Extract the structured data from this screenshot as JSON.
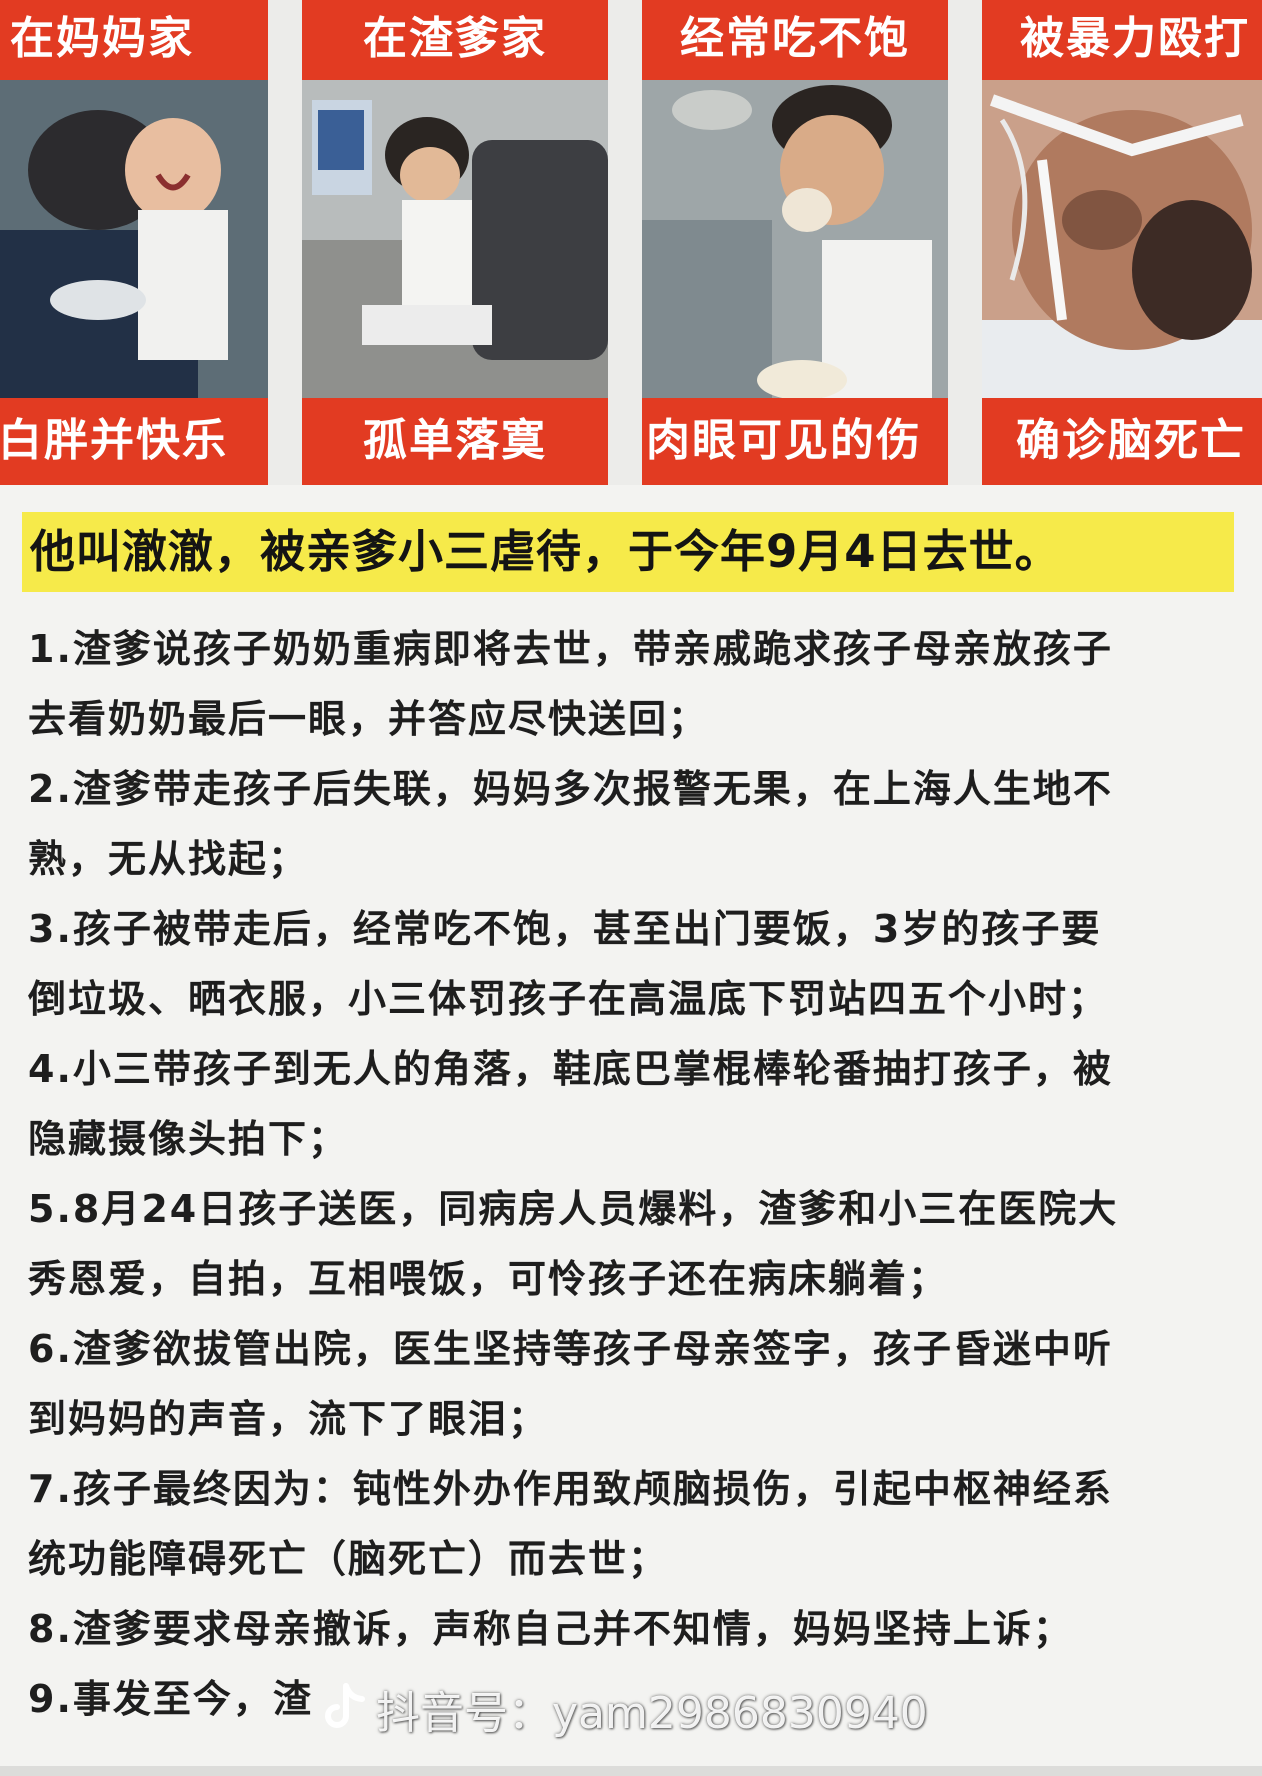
{
  "panels": [
    {
      "top": "在妈妈家",
      "bottom": "白胖并快乐"
    },
    {
      "top": "在渣爹家",
      "bottom": "孤单落寞"
    },
    {
      "top": "经常吃不饱",
      "bottom": "肉眼可见的伤"
    },
    {
      "top": "被暴力殴打",
      "bottom": "确诊脑死亡"
    }
  ],
  "headline": "他叫澈澈，被亲爹小三虐待，于今年9月4日去世。",
  "items": [
    "1.渣爹说孩子奶奶重病即将去世，带亲戚跪求孩子母亲放孩子",
    "去看奶奶最后一眼，并答应尽快送回；",
    "2.渣爹带走孩子后失联，妈妈多次报警无果，在上海人生地不",
    "熟，无从找起；",
    "3.孩子被带走后，经常吃不饱，甚至出门要饭，3岁的孩子要",
    "倒垃圾、晒衣服，小三体罚孩子在高温底下罚站四五个小时；",
    "4.小三带孩子到无人的角落，鞋底巴掌棍棒轮番抽打孩子，被",
    "隐藏摄像头拍下；",
    "5.8月24日孩子送医，同病房人员爆料，渣爹和小三在医院大",
    "秀恩爱，自拍，互相喂饭，可怜孩子还在病床躺着；",
    "6.渣爹欲拔管出院，医生坚持等孩子母亲签字，孩子昏迷中听",
    "到妈妈的声音，流下了眼泪；",
    "7.孩子最终因为：钝性外办作用致颅脑损伤，引起中枢神经系",
    "统功能障碍死亡（脑死亡）而去世；",
    "8.渣爹要求母亲撤诉，声称自己并不知情，妈妈坚持上诉；",
    "9.事发至今，渣"
  ],
  "watermark": {
    "icon": "douyin-note-icon",
    "label": "抖音号：",
    "id": "yam2986830940"
  }
}
